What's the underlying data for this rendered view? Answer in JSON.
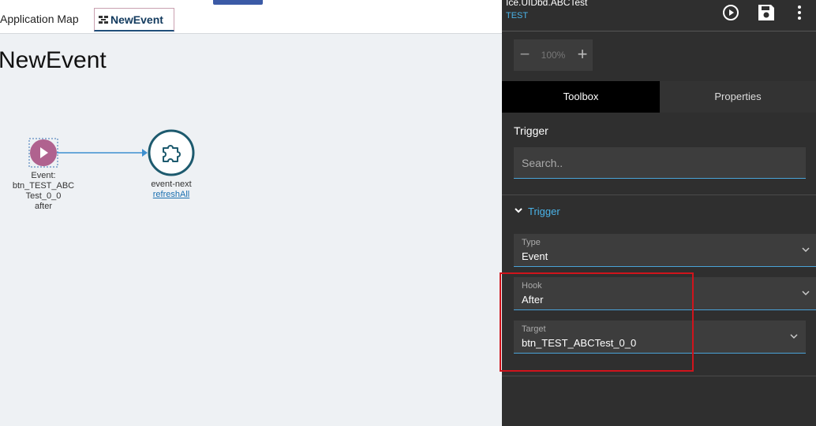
{
  "tabs": {
    "app_map": "Application Map",
    "new_event": "NewEvent"
  },
  "page": {
    "title": "NewEvent"
  },
  "flow": {
    "event_node": {
      "lines": [
        "Event:",
        "btn_TEST_ABC",
        "Test_0_0",
        "after"
      ]
    },
    "action_node": {
      "name": "event-next",
      "link": "refreshAll"
    }
  },
  "panel": {
    "path": "Ice.UIDbd.ABCTest",
    "app": "TEST",
    "zoom": "100%",
    "tabs": {
      "toolbox": "Toolbox",
      "properties": "Properties"
    },
    "trigger_title": "Trigger",
    "search_placeholder": "Search..",
    "section_label": "Trigger",
    "fields": {
      "type": {
        "label": "Type",
        "value": "Event"
      },
      "hook": {
        "label": "Hook",
        "value": "After"
      },
      "target": {
        "label": "Target",
        "value": "btn_TEST_ABCTest_0_0"
      }
    }
  },
  "colors": {
    "accent": "#4ab3e8",
    "event_node": "#b0628f",
    "action_node": "#1d5a6e",
    "highlight": "#d0141c"
  }
}
